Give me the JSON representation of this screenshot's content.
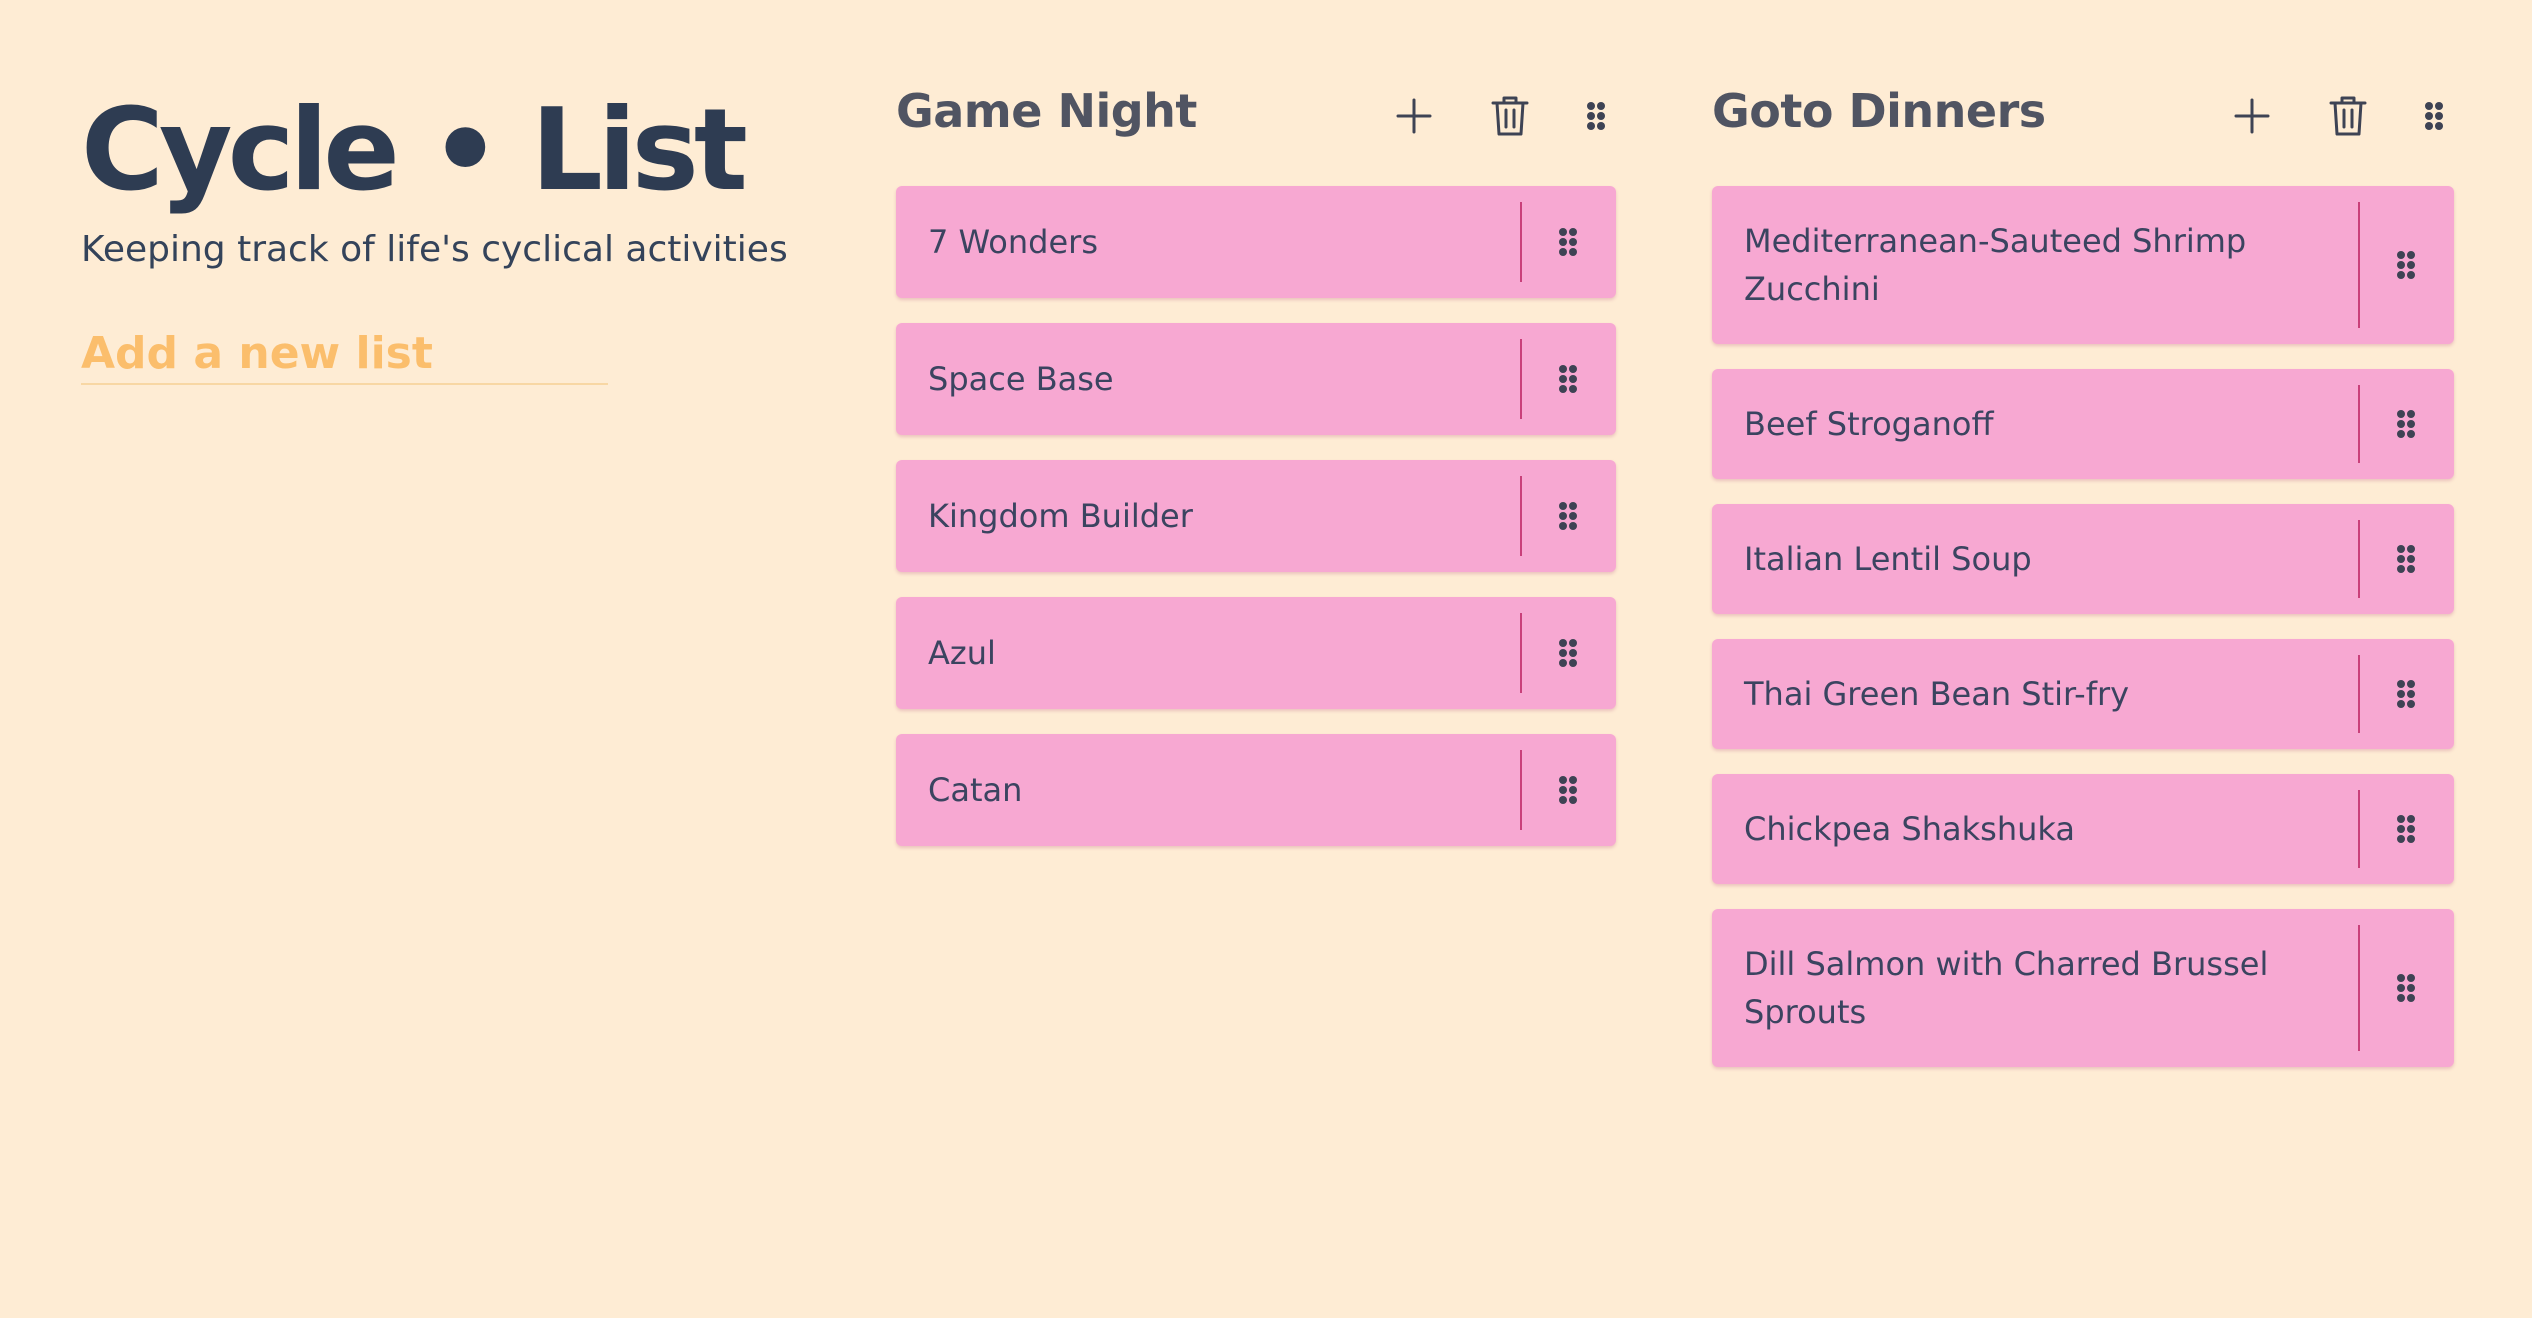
{
  "app": {
    "title": "Cycle • List",
    "subtitle": "Keeping track of life's cyclical activities",
    "new_list_placeholder": "Add a new list"
  },
  "colors": {
    "background": "#feecd4",
    "item_background": "#f7a8d2",
    "divider": "#c9407a",
    "title_text": "#2e3c52",
    "accent_placeholder": "#fbbe6c"
  },
  "icons": {
    "add": "plus-icon",
    "delete": "trash-icon",
    "drag": "drag-dots-icon"
  },
  "lists": [
    {
      "title": "Game Night",
      "items": [
        "7 Wonders",
        "Space Base",
        "Kingdom Builder",
        "Azul",
        "Catan"
      ]
    },
    {
      "title": "Goto Dinners",
      "items": [
        "Mediterranean-Sauteed Shrimp Zucchini",
        "Beef Stroganoff",
        "Italian Lentil Soup",
        "Thai Green Bean Stir-fry",
        "Chickpea Shakshuka",
        "Dill Salmon with Charred Brussel Sprouts"
      ]
    }
  ]
}
